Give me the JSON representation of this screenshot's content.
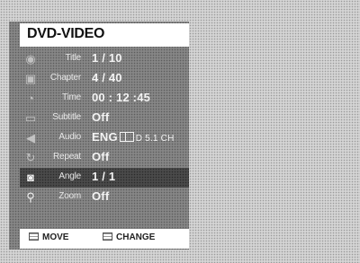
{
  "menu": {
    "title": "DVD-VIDEO",
    "rows": [
      {
        "label": "Title",
        "value": "1 / 10",
        "icon": "title-icon"
      },
      {
        "label": "Chapter",
        "value": "4 / 40",
        "icon": "chapter-icon"
      },
      {
        "label": "Time",
        "value": "00 : 12 :45",
        "icon": "clock-icon"
      },
      {
        "label": "Subtitle",
        "value": "Off",
        "icon": "subtitle-icon"
      },
      {
        "label": "Audio",
        "value_prefix": "ENG",
        "value_suffix": "D 5.1 CH",
        "icon": "speaker-icon"
      },
      {
        "label": "Repeat",
        "value": "Off",
        "icon": "repeat-icon"
      },
      {
        "label": "Angle",
        "value": "1 / 1",
        "icon": "camera-icon",
        "selected": true
      },
      {
        "label": "Zoom",
        "value": "Off",
        "icon": "magnifier-icon"
      }
    ]
  },
  "footer": {
    "move_label": "MOVE",
    "change_label": "CHANGE"
  }
}
